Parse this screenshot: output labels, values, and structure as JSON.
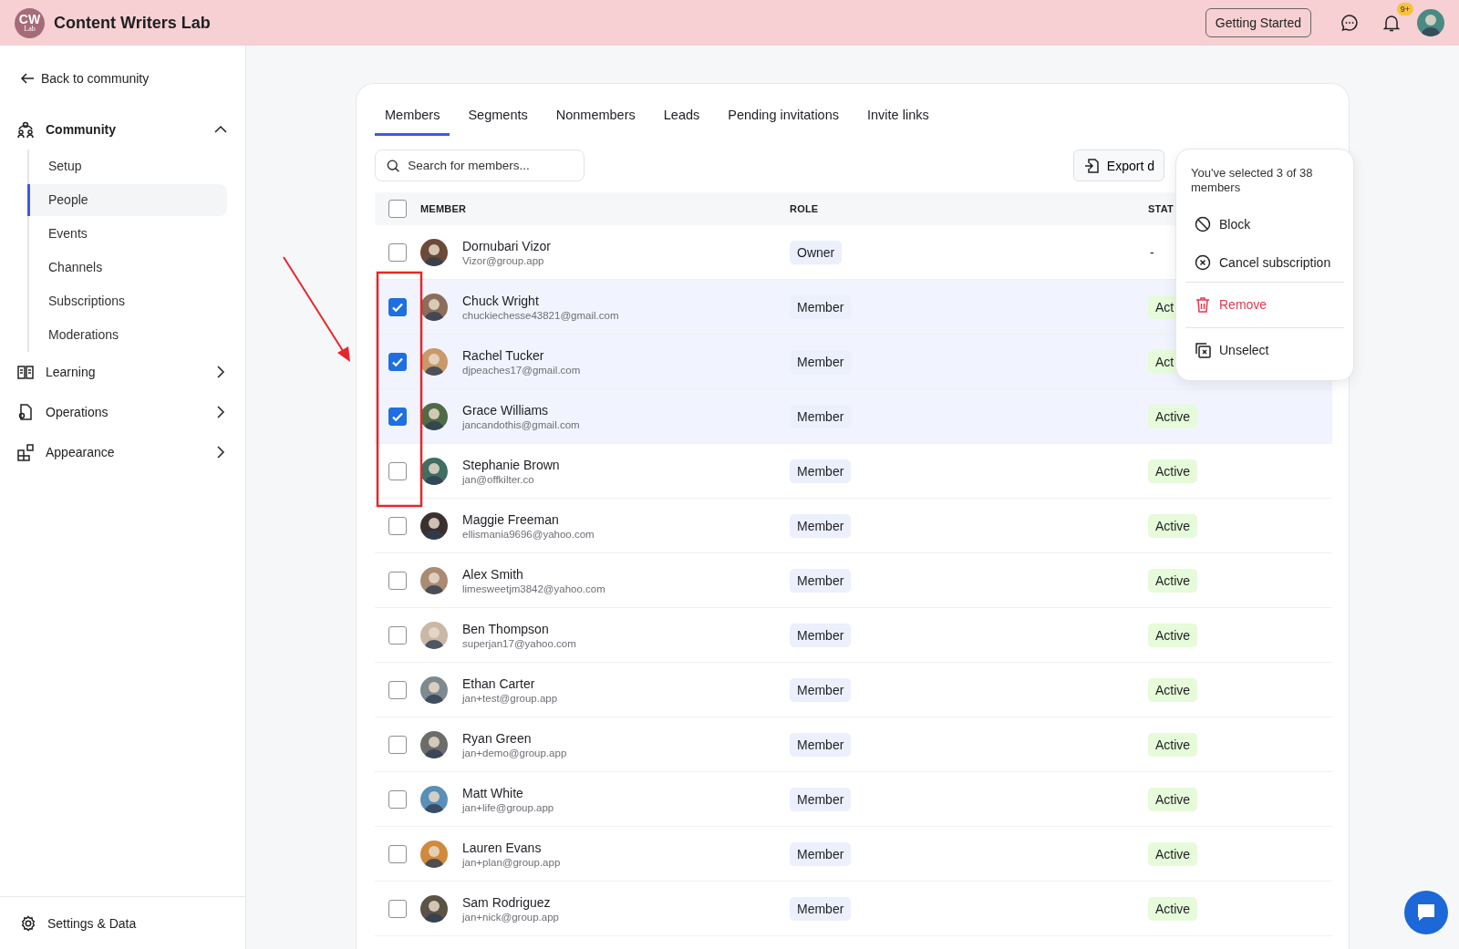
{
  "app": {
    "logo": "CW",
    "logo_sub": "Lab",
    "title": "Content Writers Lab"
  },
  "header": {
    "button": "Getting Started",
    "notification_badge": "9+"
  },
  "sidebar": {
    "back": "Back to community",
    "sections": [
      {
        "label": "Community",
        "kind": "community",
        "expanded": true,
        "children": [
          {
            "label": "Setup",
            "selected": false
          },
          {
            "label": "People",
            "selected": true
          },
          {
            "label": "Events",
            "selected": false
          },
          {
            "label": "Channels",
            "selected": false
          },
          {
            "label": "Subscriptions",
            "selected": false
          },
          {
            "label": "Moderations",
            "selected": false
          }
        ]
      },
      {
        "label": "Learning",
        "kind": "learning",
        "expanded": false
      },
      {
        "label": "Operations",
        "kind": "operations",
        "expanded": false
      },
      {
        "label": "Appearance",
        "kind": "appearance",
        "expanded": false
      }
    ],
    "footer": "Settings & Data"
  },
  "tabs": [
    {
      "label": "Members",
      "selected": true
    },
    {
      "label": "Segments",
      "selected": false
    },
    {
      "label": "Nonmembers",
      "selected": false
    },
    {
      "label": "Leads",
      "selected": false
    },
    {
      "label": "Pending invitations",
      "selected": false
    },
    {
      "label": "Invite links",
      "selected": false
    }
  ],
  "search": {
    "placeholder": "Search for members..."
  },
  "export_button": "Export d",
  "table": {
    "select_all_checked": false,
    "columns": [
      "MEMBER",
      "ROLE",
      "STAT"
    ],
    "rows": [
      {
        "name": "Dornubari Vizor",
        "email": "Vizor@group.app",
        "role": "Owner",
        "status": "-",
        "kind": "plain",
        "checked": false
      },
      {
        "name": "Chuck Wright",
        "email": "chuckiechesse43821@gmail.com",
        "role": "Member",
        "status": "Act",
        "kind": "badge",
        "checked": true
      },
      {
        "name": "Rachel Tucker",
        "email": "djpeaches17@gmail.com",
        "role": "Member",
        "status": "Act",
        "kind": "badge",
        "checked": true
      },
      {
        "name": "Grace Williams",
        "email": "jancandothis@gmail.com",
        "role": "Member",
        "status": "Active",
        "kind": "badge",
        "checked": true
      },
      {
        "name": "Stephanie Brown",
        "email": "jan@offkilter.co",
        "role": "Member",
        "status": "Active",
        "kind": "badge",
        "checked": false
      },
      {
        "name": "Maggie Freeman",
        "email": "ellismania9696@yahoo.com",
        "role": "Member",
        "status": "Active",
        "kind": "badge",
        "checked": false
      },
      {
        "name": "Alex Smith",
        "email": "limesweetjm3842@yahoo.com",
        "role": "Member",
        "status": "Active",
        "kind": "badge",
        "checked": false
      },
      {
        "name": "Ben Thompson",
        "email": "superjan17@yahoo.com",
        "role": "Member",
        "status": "Active",
        "kind": "badge",
        "checked": false
      },
      {
        "name": "Ethan Carter",
        "email": "jan+test@group.app",
        "role": "Member",
        "status": "Active",
        "kind": "badge",
        "checked": false
      },
      {
        "name": "Ryan Green",
        "email": "jan+demo@group.app",
        "role": "Member",
        "status": "Active",
        "kind": "badge",
        "checked": false
      },
      {
        "name": "Matt White",
        "email": "jan+life@group.app",
        "role": "Member",
        "status": "Active",
        "kind": "badge",
        "checked": false
      },
      {
        "name": "Lauren Evans",
        "email": "jan+plan@group.app",
        "role": "Member",
        "status": "Active",
        "kind": "badge",
        "checked": false
      },
      {
        "name": "Sam Rodriguez",
        "email": "jan+nick@group.app",
        "role": "Member",
        "status": "Active",
        "kind": "badge",
        "checked": false
      }
    ]
  },
  "selection_menu": {
    "summary": "You've selected 3 of 38 members",
    "items": [
      {
        "label": "Block",
        "kind": "block",
        "divider_before": false
      },
      {
        "label": "Cancel subscription",
        "kind": "cancel",
        "divider_before": false
      },
      {
        "label": "Remove",
        "kind": "remove",
        "divider_before": true
      },
      {
        "label": "Unselect",
        "kind": "unselect",
        "divider_before": true
      }
    ]
  }
}
